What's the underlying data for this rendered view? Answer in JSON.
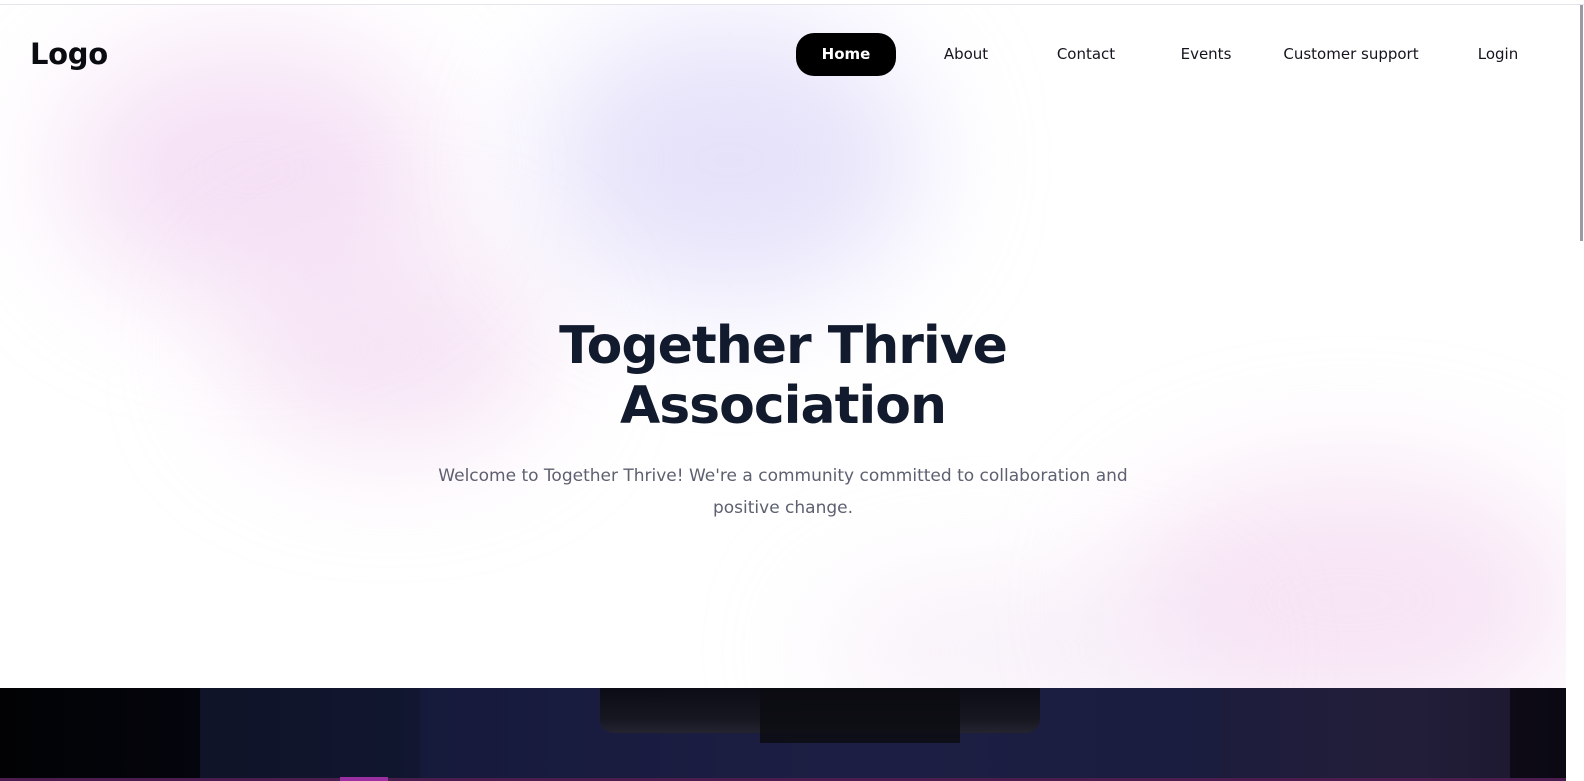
{
  "header": {
    "logo": "Logo",
    "nav": [
      {
        "label": "Home",
        "active": true
      },
      {
        "label": "About",
        "active": false
      },
      {
        "label": "Contact",
        "active": false
      },
      {
        "label": "Events",
        "active": false
      },
      {
        "label": "Customer support",
        "active": false
      },
      {
        "label": "Login",
        "active": false
      }
    ]
  },
  "hero": {
    "title_line1": "Together Thrive",
    "title_line2": "Association",
    "subtitle": "Welcome to Together Thrive! We're a community committed to collaboration and positive change."
  },
  "colors": {
    "nav_active_bg": "#000000",
    "title": "#121a2d",
    "subtitle": "#5d6070",
    "dark_section": "#111533"
  }
}
